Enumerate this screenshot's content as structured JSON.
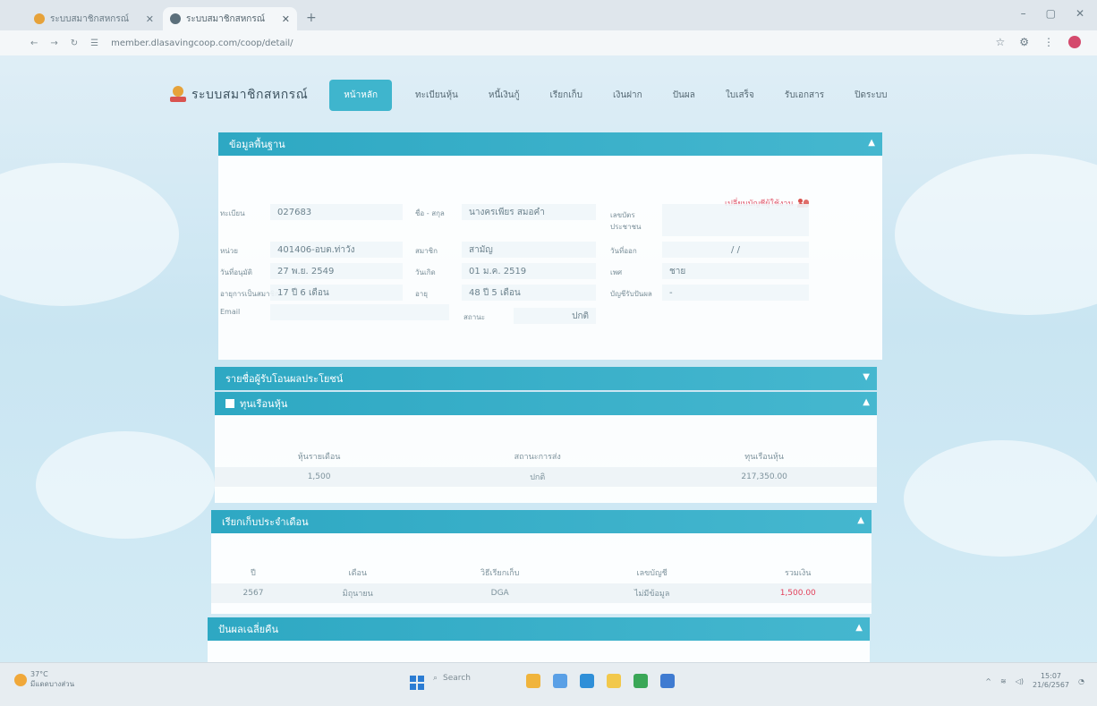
{
  "browser": {
    "tabs": [
      {
        "label": "ระบบสมาชิกสหกรณ์",
        "active": false,
        "favicon_color": "#e6a23a"
      },
      {
        "label": "ระบบสมาชิกสหกรณ์",
        "active": true,
        "favicon_color": "#5b6f7b"
      }
    ],
    "new_tab_symbol": "+",
    "url": "member.dlasavingcoop.com/coop/detail/",
    "controls": {
      "minimize": "–",
      "maximize": "▢",
      "close": "✕"
    }
  },
  "nav": {
    "logo_text": "ระบบสมาชิกสหกรณ์",
    "items": [
      {
        "label": "หน้าหลัก",
        "active": true
      },
      {
        "label": "ทะเบียนหุ้น",
        "active": false
      },
      {
        "label": "หนี้เงินกู้",
        "active": false
      },
      {
        "label": "เรียกเก็บ",
        "active": false
      },
      {
        "label": "เงินฝาก",
        "active": false
      },
      {
        "label": "ปันผล",
        "active": false
      },
      {
        "label": "ใบเสร็จ",
        "active": false
      },
      {
        "label": "รับเอกสาร",
        "active": false
      },
      {
        "label": "ปิดระบบ",
        "active": false
      }
    ]
  },
  "basic_info": {
    "title": "ข้อมูลพื้นฐาน",
    "switch_account": "เปลี่ยนบัญชีผู้ใช้งาน",
    "fields": {
      "member_no": {
        "label": "ทะเบียน",
        "value": "027683"
      },
      "name": {
        "label": "ชื่อ - สกุล",
        "value": "นางครเพียร สมอคำ"
      },
      "id_card": {
        "label": "เลขบัตรประชาชน",
        "value": ""
      },
      "unit": {
        "label": "หน่วย",
        "value": "401406-อบต.ท่าวัง"
      },
      "member_type": {
        "label": "สมาชิก",
        "value": "สามัญ"
      },
      "resign_date": {
        "label": "วันที่ออก",
        "value": "/ /"
      },
      "join_date": {
        "label": "วันที่อนุมัติ",
        "value": "27 พ.ย. 2549"
      },
      "birth_date": {
        "label": "วันเกิด",
        "value": "01 ม.ค. 2519"
      },
      "gender": {
        "label": "เพศ",
        "value": "ชาย"
      },
      "member_age": {
        "label": "อายุการเป็นสมาชิก",
        "value": "17 ปี 6 เดือน"
      },
      "age": {
        "label": "อายุ",
        "value": "48 ปี 5 เดือน"
      },
      "dividend_account": {
        "label": "บัญชีรับปันผล",
        "value": "-"
      },
      "email": {
        "label": "Email",
        "value": ""
      },
      "status": {
        "label": "สถานะ",
        "value": "ปกติ"
      }
    }
  },
  "beneficiaries": {
    "title": "รายชื่อผู้รับโอนผลประโยชน์"
  },
  "shares": {
    "title": "ทุนเรือนหุ้น",
    "columns": [
      "หุ้นรายเดือน",
      "สถานะการส่ง",
      "ทุนเรือนหุ้น"
    ],
    "rows": [
      [
        "1,500",
        "ปกติ",
        "217,350.00"
      ]
    ]
  },
  "monthly_collection": {
    "title": "เรียกเก็บประจำเดือน",
    "columns": [
      "ปี",
      "เดือน",
      "วิธีเรียกเก็บ",
      "เลขบัญชี",
      "รวมเงิน"
    ],
    "rows": [
      [
        "2567",
        "มิถุนายน",
        "DGA",
        "ไม่มีข้อมูล",
        "1,500.00"
      ]
    ]
  },
  "dividend": {
    "title": "ปันผลเฉลี่ยคืน"
  },
  "taskbar": {
    "weather_temp": "37°C",
    "weather_desc": "มีแดดบางส่วน",
    "search_label": "Search",
    "clock_time": "15:07",
    "clock_date": "21/6/2567"
  },
  "colors": {
    "accent": "#3fb5cd",
    "alert": "#e2415b"
  }
}
